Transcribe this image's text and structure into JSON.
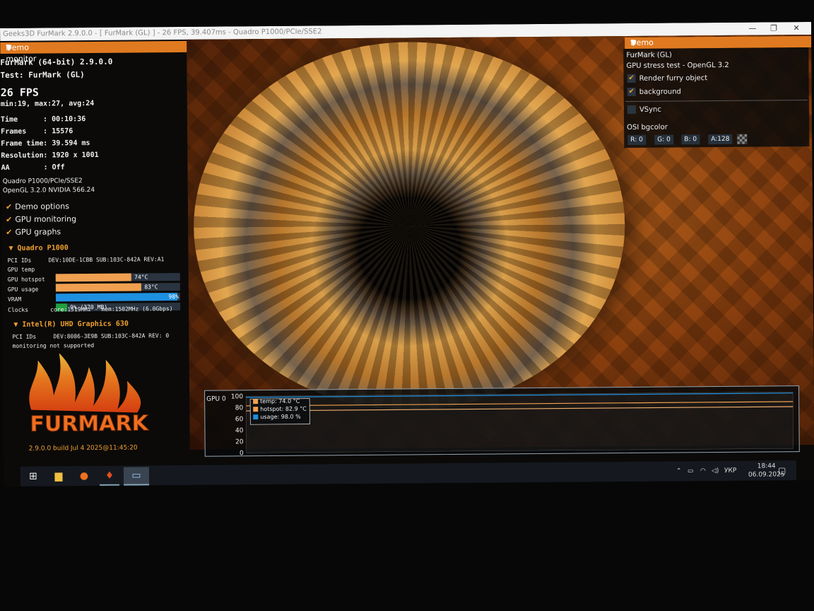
{
  "window": {
    "title": "Geeks3D FurMark 2.9.0.0 - [ FurMark (GL) ] - 26 FPS, 39.407ms - Quadro P1000/PCIe/SSE2",
    "min": "—",
    "max": "❐",
    "close": "✕"
  },
  "monitor": {
    "header": "Demo monitor",
    "app": "FurMark (64-bit) 2.9.0.0",
    "test": "Test: FurMark (GL)",
    "fps": "26 FPS",
    "minmax": "min:19, max:27, avg:24",
    "stats": [
      {
        "label": "Time",
        "value": ": 00:10:36"
      },
      {
        "label": "Frames",
        "value": ": 15576"
      },
      {
        "label": "Frame time",
        "value": ": 39.594 ms"
      },
      {
        "label": "Resolution",
        "value": ": 1920 x 1001"
      },
      {
        "label": "AA",
        "value": ": Off"
      }
    ],
    "renderer": "Quadro P1000/PCIe/SSE2",
    "opengl": "OpenGL 3.2.0 NVIDIA 566.24",
    "checks": [
      "Demo options",
      "GPU monitoring",
      "GPU graphs"
    ]
  },
  "gpu1": {
    "name": "Quadro P1000",
    "pci_label": "PCI IDs",
    "pci": "DEV:10DE-1CBB SUB:103C-842A REV:A1",
    "rows": [
      {
        "label": "GPU temp",
        "value": "74°C",
        "level": 0.61,
        "color": "#f0a050"
      },
      {
        "label": "GPU hotspot",
        "value": "83°C",
        "level": 0.69,
        "color": "#f0a050"
      },
      {
        "label": "GPU usage",
        "value": "98%",
        "level": 0.98,
        "color": "#1e90e0"
      },
      {
        "label": "VRAM",
        "value": "9% (370 MB)",
        "level": 0.09,
        "color": "#20a040"
      }
    ],
    "clocks_label": "Clocks",
    "clocks": "core:1519MHz - mem:1502MHz (6.0Gbps)"
  },
  "gpu2": {
    "name": "Intel(R) UHD Graphics 630",
    "pci_label": "PCI IDs",
    "pci": "DEV:8086-3E9B SUB:103C-842A REV: 0",
    "note": "monitoring not supported"
  },
  "logo": {
    "text": "FURMARK",
    "build": "2.9.0.0 build Jul  4 2025@11:45:20"
  },
  "options": {
    "header": "Demo options",
    "name": "FurMark (GL)",
    "desc": "GPU stress test - OpenGL 3.2",
    "checks": [
      {
        "label": "Render furry object",
        "checked": "✔"
      },
      {
        "label": "background",
        "checked": "✔"
      }
    ],
    "vsync": "VSync",
    "bgcolor_label": "OSI bgcolor",
    "bgcolor": [
      "R: 0",
      "G: 0",
      "B: 0",
      "A:128"
    ]
  },
  "graph": {
    "title": "GPU 0",
    "yticks": [
      "100",
      "80",
      "60",
      "40",
      "20",
      "0"
    ],
    "legend": [
      {
        "label": "temp: 74.0 °C",
        "color": "#f0a050"
      },
      {
        "label": "hotspot: 82.9 °C",
        "color": "#f0a050"
      },
      {
        "label": "usage: 98.0 %",
        "color": "#1e90e0"
      }
    ],
    "series": {
      "temp": 74.0,
      "hotspot": 82.9,
      "usage": 98.0
    }
  },
  "taskbar": {
    "lang": "УКР",
    "time": "18:44",
    "date": "06.09.2025"
  }
}
